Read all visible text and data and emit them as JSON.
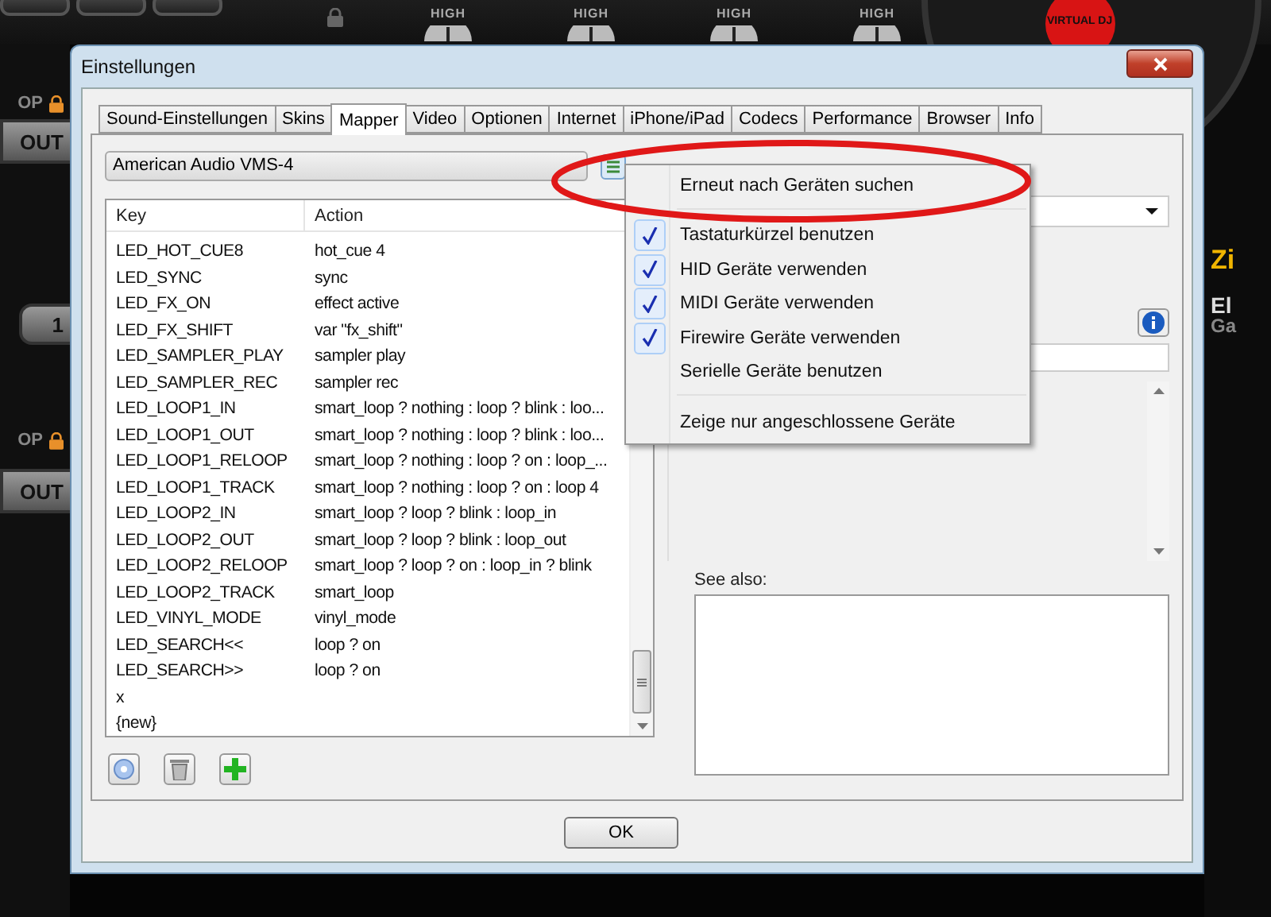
{
  "background": {
    "top_labels": [
      "HIGH",
      "HIGH",
      "HIGH",
      "HIGH"
    ],
    "logo": "VIRTUAL DJ",
    "left": [
      {
        "kind": "lock",
        "label": "OP"
      },
      {
        "kind": "button",
        "label": "OUT"
      },
      {
        "kind": "button",
        "label": "1"
      },
      {
        "kind": "lock",
        "label": "OP"
      },
      {
        "kind": "button",
        "label": "OUT"
      }
    ],
    "right": [
      {
        "kind": "title",
        "label": "Zi"
      },
      {
        "kind": "name",
        "label": "El"
      },
      {
        "kind": "sub",
        "label": "Ga"
      }
    ]
  },
  "dialog": {
    "title": "Einstellungen",
    "tabs": [
      {
        "label": "Sound-Einstellungen",
        "selected": false
      },
      {
        "label": "Skins",
        "selected": false
      },
      {
        "label": "Mapper",
        "selected": true
      },
      {
        "label": "Video",
        "selected": false
      },
      {
        "label": "Optionen",
        "selected": false
      },
      {
        "label": "Internet",
        "selected": false
      },
      {
        "label": "iPhone/iPad",
        "selected": false
      },
      {
        "label": "Codecs",
        "selected": false
      },
      {
        "label": "Performance",
        "selected": false
      },
      {
        "label": "Browser",
        "selected": false
      },
      {
        "label": "Info",
        "selected": false
      }
    ],
    "device_select": {
      "value": "American Audio VMS-4"
    },
    "table": {
      "columns": [
        "Key",
        "Action"
      ],
      "rows": [
        {
          "key": "LED_HOT_CUE8",
          "action": "hot_cue 4"
        },
        {
          "key": "LED_SYNC",
          "action": "sync"
        },
        {
          "key": "LED_FX_ON",
          "action": "effect active"
        },
        {
          "key": "LED_FX_SHIFT",
          "action": "var \"fx_shift\""
        },
        {
          "key": "LED_SAMPLER_PLAY",
          "action": "sampler play"
        },
        {
          "key": "LED_SAMPLER_REC",
          "action": "sampler rec"
        },
        {
          "key": "LED_LOOP1_IN",
          "action": "smart_loop ? nothing : loop ? blink : loo..."
        },
        {
          "key": "LED_LOOP1_OUT",
          "action": "smart_loop ? nothing : loop ? blink : loo..."
        },
        {
          "key": "LED_LOOP1_RELOOP",
          "action": "smart_loop ? nothing : loop ? on : loop_..."
        },
        {
          "key": "LED_LOOP1_TRACK",
          "action": "smart_loop ? nothing : loop ? on : loop 4"
        },
        {
          "key": "LED_LOOP2_IN",
          "action": "smart_loop ? loop ? blink : loop_in"
        },
        {
          "key": "LED_LOOP2_OUT",
          "action": "smart_loop ? loop ? blink : loop_out"
        },
        {
          "key": "LED_LOOP2_RELOOP",
          "action": "smart_loop ? loop ? on : loop_in ? blink"
        },
        {
          "key": "LED_LOOP2_TRACK",
          "action": "smart_loop"
        },
        {
          "key": "LED_VINYL_MODE",
          "action": "vinyl_mode"
        },
        {
          "key": "LED_SEARCH<<",
          "action": "loop ? on"
        },
        {
          "key": "LED_SEARCH>>",
          "action": "loop ? on"
        },
        {
          "key": "x"
        },
        {
          "key": "{new}"
        }
      ]
    },
    "see_also": {
      "label": "See also:"
    },
    "ok_button": "OK"
  },
  "context_menu": {
    "items": [
      {
        "kind": "command",
        "label": "Erneut nach Geräten suchen"
      },
      {
        "kind": "separator"
      },
      {
        "kind": "check",
        "label": "Tastaturkürzel benutzen",
        "checked": true
      },
      {
        "kind": "check",
        "label": "HID Geräte verwenden",
        "checked": true
      },
      {
        "kind": "check",
        "label": "MIDI Geräte verwenden",
        "checked": true
      },
      {
        "kind": "check",
        "label": "Firewire Geräte verwenden",
        "checked": true
      },
      {
        "kind": "check",
        "label": "Serielle Geräte benutzen",
        "checked": false
      },
      {
        "kind": "separator"
      },
      {
        "kind": "command",
        "label": "Zeige nur angeschlossene Geräte"
      }
    ]
  }
}
